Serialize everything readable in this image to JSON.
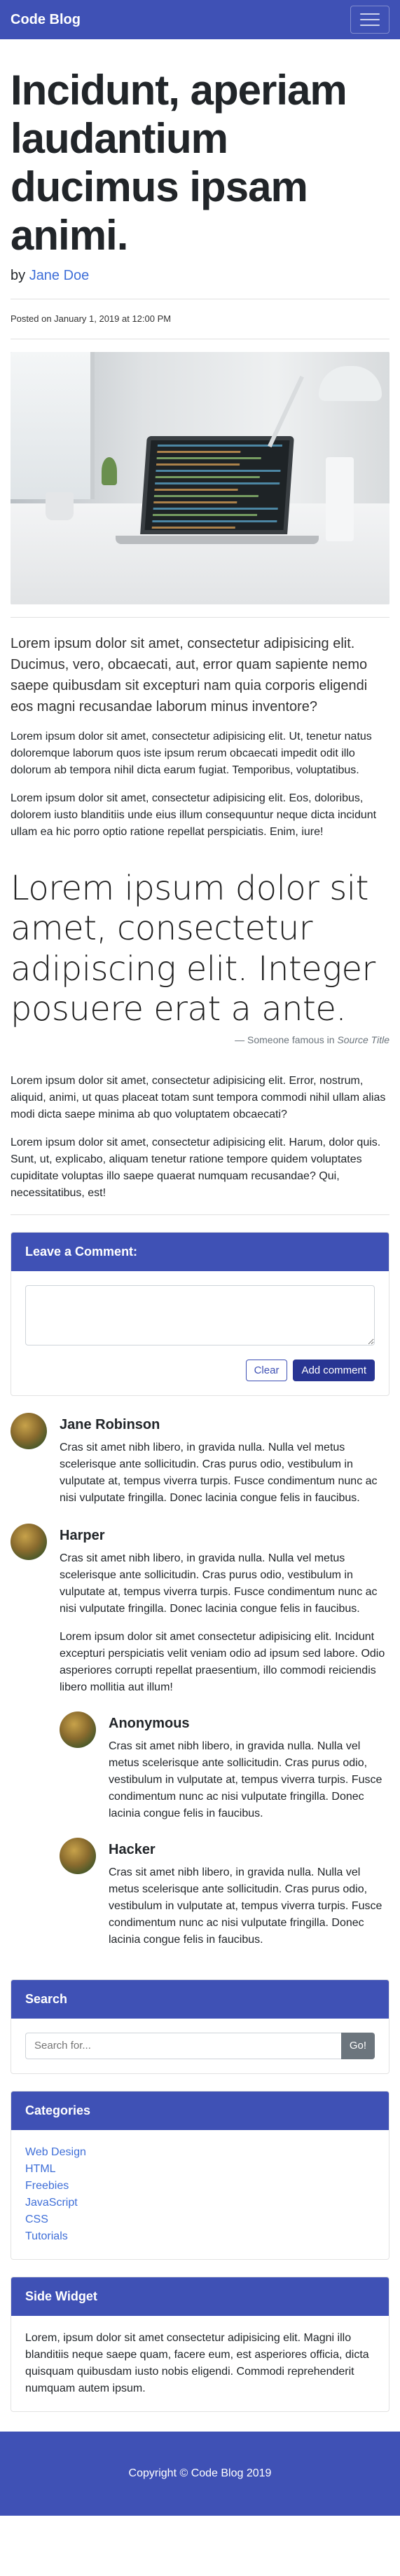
{
  "navbar": {
    "brand": "Code Blog",
    "toggler_icon": "hamburger-icon"
  },
  "post": {
    "title": "Incidunt, aperiam laudantium ducimus ipsam animi.",
    "by_prefix": "by",
    "author": "Jane Doe",
    "posted": "Posted on January 1, 2019 at 12:00 PM",
    "lead": "Lorem ipsum dolor sit amet, consectetur adipisicing elit. Ducimus, vero, obcaecati, aut, error quam sapiente nemo saepe quibusdam sit excepturi nam quia corporis eligendi eos magni recusandae laborum minus inventore?",
    "paragraphs": [
      "Lorem ipsum dolor sit amet, consectetur adipisicing elit. Ut, tenetur natus doloremque laborum quos iste ipsum rerum obcaecati impedit odit illo dolorum ab tempora nihil dicta earum fugiat. Temporibus, voluptatibus.",
      "Lorem ipsum dolor sit amet, consectetur adipisicing elit. Eos, doloribus, dolorem iusto blanditiis unde eius illum consequuntur neque dicta incidunt ullam ea hic porro optio ratione repellat perspiciatis. Enim, iure!"
    ],
    "quote": "Lorem ipsum dolor sit amet, consectetur adipiscing elit. Integer posuere erat a ante.",
    "quote_attribution": "— Someone famous in",
    "quote_source": "Source Title",
    "paragraphs_after": [
      "Lorem ipsum dolor sit amet, consectetur adipisicing elit. Error, nostrum, aliquid, animi, ut quas placeat totam sunt tempora commodi nihil ullam alias modi dicta saepe minima ab quo voluptatem obcaecati?",
      "Lorem ipsum dolor sit amet, consectetur adipisicing elit. Harum, dolor quis. Sunt, ut, explicabo, aliquam tenetur ratione tempore quidem voluptates cupiditate voluptas illo saepe quaerat numquam recusandae? Qui, necessitatibus, est!"
    ]
  },
  "comment_form": {
    "header": "Leave a Comment:",
    "textarea_value": "",
    "clear_label": "Clear",
    "submit_label": "Add comment"
  },
  "comments": [
    {
      "name": "Jane Robinson",
      "text": "Cras sit amet nibh libero, in gravida nulla. Nulla vel metus scelerisque ante sollicitudin. Cras purus odio, vestibulum in vulputate at, tempus viverra turpis. Fusce condimentum nunc ac nisi vulputate fringilla. Donec lacinia congue felis in faucibus."
    },
    {
      "name": "Harper",
      "text": "Cras sit amet nibh libero, in gravida nulla. Nulla vel metus scelerisque ante sollicitudin. Cras purus odio, vestibulum in vulputate at, tempus viverra turpis. Fusce condimentum nunc ac nisi vulputate fringilla. Donec lacinia congue felis in faucibus.",
      "extra": "Lorem ipsum dolor sit amet consectetur adipisicing elit. Incidunt excepturi perspiciatis velit veniam odio ad ipsum sed labore. Odio asperiores corrupti repellat praesentium, illo commodi reiciendis libero mollitia aut illum!",
      "replies": [
        {
          "name": "Anonymous",
          "text": "Cras sit amet nibh libero, in gravida nulla. Nulla vel metus scelerisque ante sollicitudin. Cras purus odio, vestibulum in vulputate at, tempus viverra turpis. Fusce condimentum nunc ac nisi vulputate fringilla. Donec lacinia congue felis in faucibus."
        },
        {
          "name": "Hacker",
          "text": "Cras sit amet nibh libero, in gravida nulla. Nulla vel metus scelerisque ante sollicitudin. Cras purus odio, vestibulum in vulputate at, tempus viverra turpis. Fusce condimentum nunc ac nisi vulputate fringilla. Donec lacinia congue felis in faucibus."
        }
      ]
    }
  ],
  "search_widget": {
    "header": "Search",
    "placeholder": "Search for...",
    "button_label": "Go!"
  },
  "categories_widget": {
    "header": "Categories",
    "items": [
      "Web Design",
      "HTML",
      "Freebies",
      "JavaScript",
      "CSS",
      "Tutorials"
    ]
  },
  "side_widget": {
    "header": "Side Widget",
    "text": "Lorem, ipsum dolor sit amet consectetur adipisicing elit. Magni illo blanditiis neque saepe quam, facere eum, est asperiores officia, dicta quisquam quibusdam iusto nobis eligendi. Commodi reprehenderit numquam autem ipsum."
  },
  "footer": {
    "copyright": "Copyright © Code Blog 2019"
  },
  "colors": {
    "primary": "#3f51b5",
    "primary_dark": "#283593",
    "link": "#3f6fd8"
  }
}
